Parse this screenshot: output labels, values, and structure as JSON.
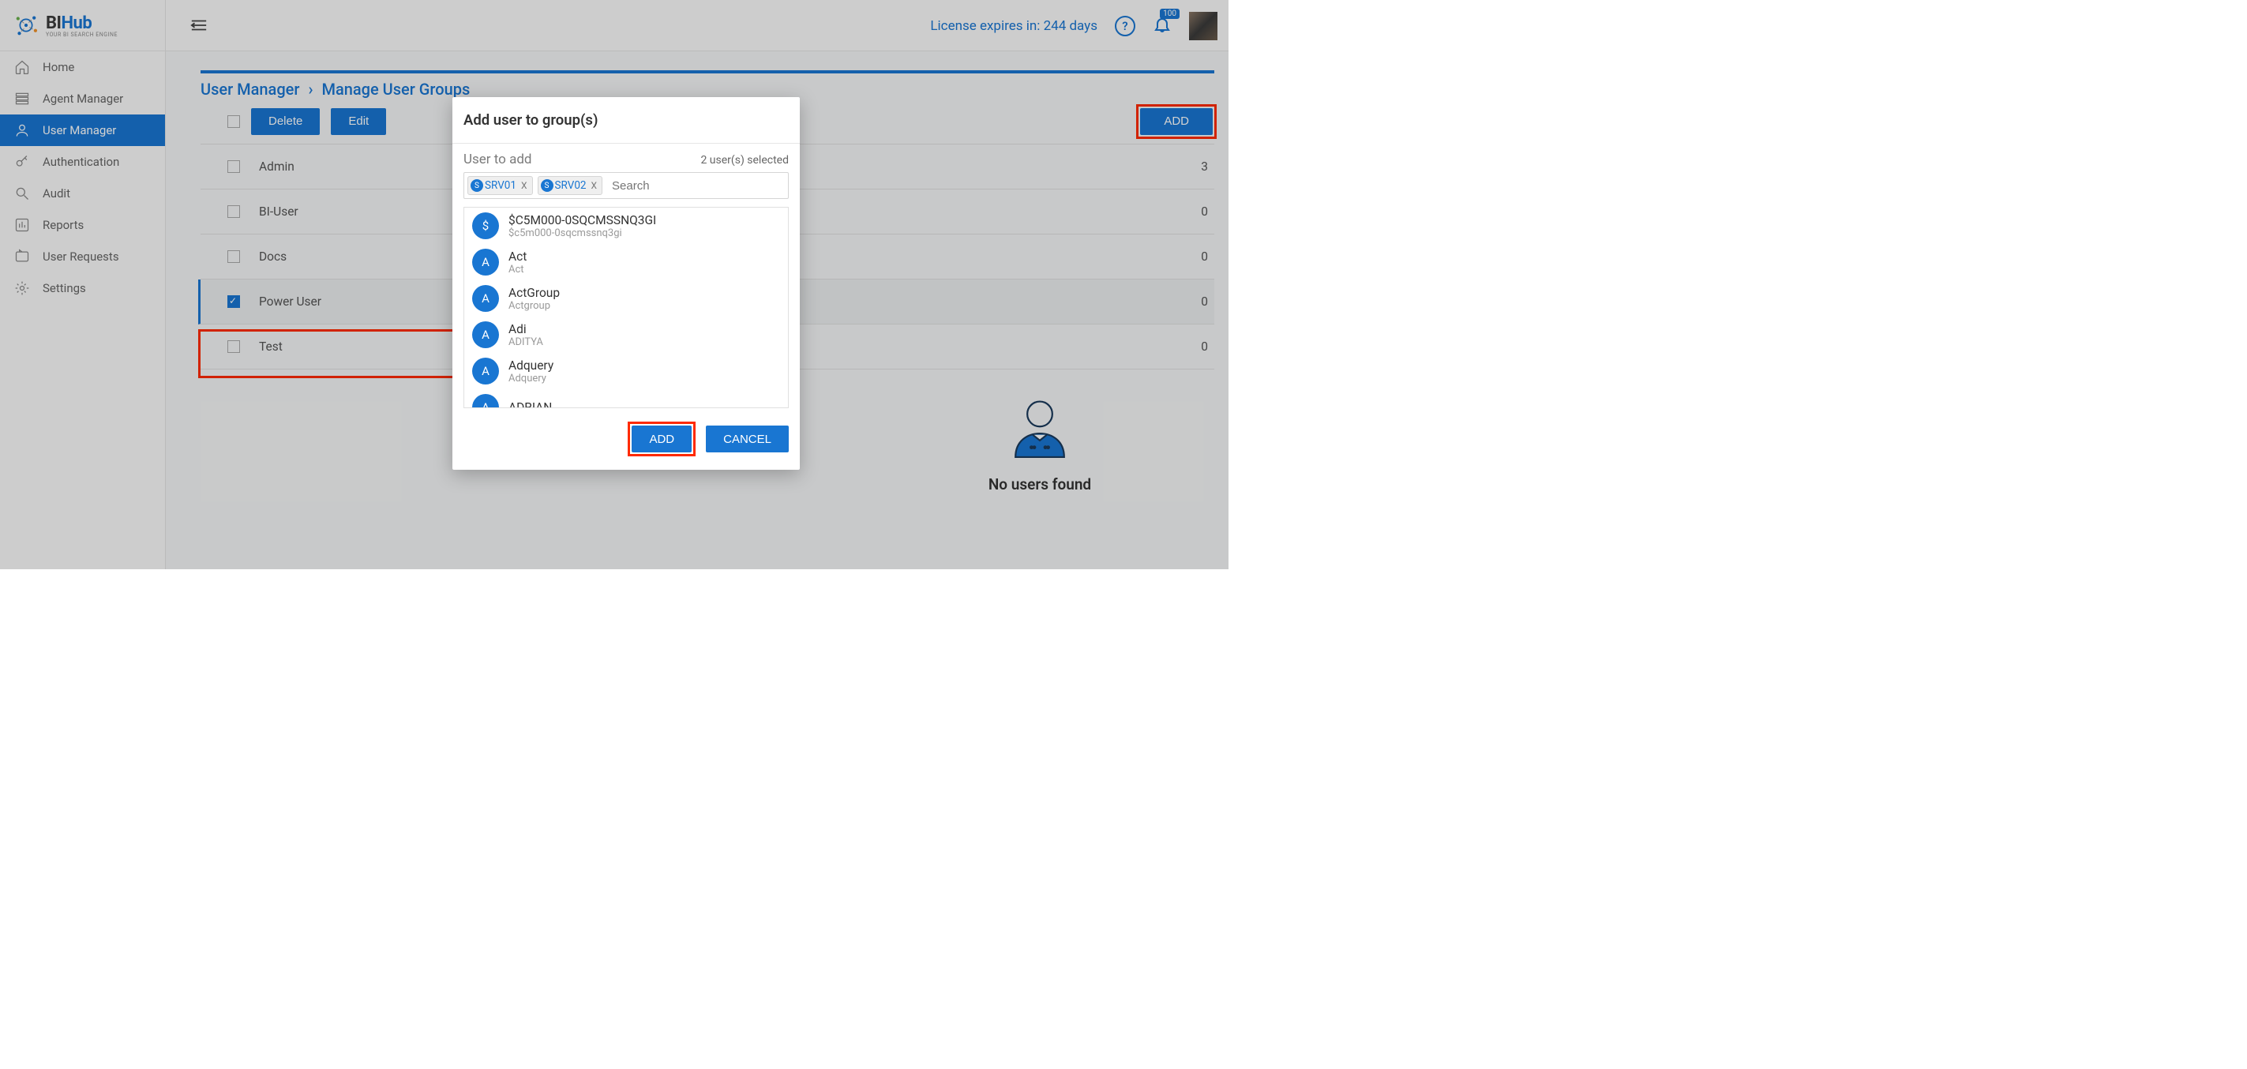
{
  "brand": {
    "name1": "BI",
    "name2": "Hub",
    "tagline": "YOUR BI SEARCH ENGINE"
  },
  "topbar": {
    "license_text": "License expires in: 244 days",
    "notif_count": "100"
  },
  "sidebar": {
    "items": [
      {
        "label": "Home"
      },
      {
        "label": "Agent Manager"
      },
      {
        "label": "User Manager"
      },
      {
        "label": "Authentication"
      },
      {
        "label": "Audit"
      },
      {
        "label": "Reports"
      },
      {
        "label": "User Requests"
      },
      {
        "label": "Settings"
      }
    ]
  },
  "breadcrumb": {
    "root": "User Manager",
    "leaf": "Manage User Groups"
  },
  "toolbar": {
    "delete": "Delete",
    "edit": "Edit",
    "add": "ADD"
  },
  "groups": [
    {
      "name": "Admin",
      "count": "3",
      "selected": false
    },
    {
      "name": "BI-User",
      "count": "0",
      "selected": false
    },
    {
      "name": "Docs",
      "count": "0",
      "selected": false
    },
    {
      "name": "Power User",
      "count": "0",
      "selected": true
    },
    {
      "name": "Test",
      "count": "0",
      "selected": false
    }
  ],
  "detail": {
    "empty_text": "No users found"
  },
  "modal": {
    "title": "Add user to group(s)",
    "field_label": "User to add",
    "selected_text": "2 user(s) selected",
    "search_placeholder": "Search",
    "chips": [
      {
        "badge": "S",
        "label": "SRV01"
      },
      {
        "badge": "S",
        "label": "SRV02"
      }
    ],
    "users": [
      {
        "avatar": "$",
        "name": "$C5M000-0SQCMSSNQ3GI",
        "sub": "$c5m000-0sqcmssnq3gi"
      },
      {
        "avatar": "A",
        "name": "Act",
        "sub": "Act"
      },
      {
        "avatar": "A",
        "name": "ActGroup",
        "sub": "Actgroup"
      },
      {
        "avatar": "A",
        "name": "Adi",
        "sub": "ADITYA"
      },
      {
        "avatar": "A",
        "name": "Adquery",
        "sub": "Adquery"
      },
      {
        "avatar": "A",
        "name": "ADRIAN",
        "sub": ""
      }
    ],
    "add": "ADD",
    "cancel": "CANCEL"
  }
}
